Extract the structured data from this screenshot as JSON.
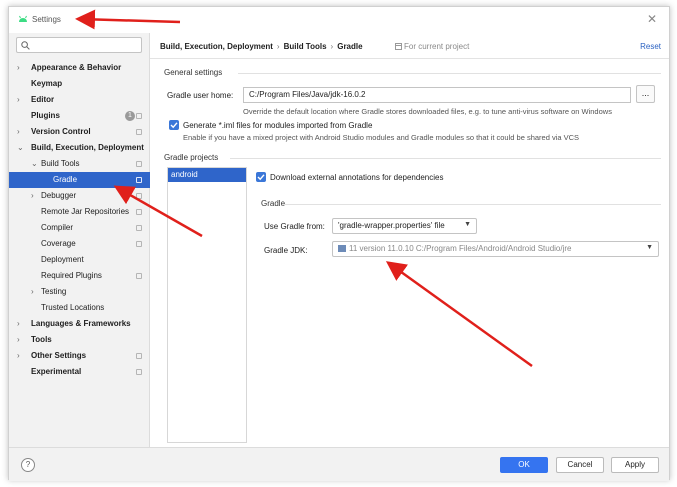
{
  "window": {
    "title": "Settings",
    "close_glyph": "✕"
  },
  "search": {
    "placeholder": ""
  },
  "sidebar": {
    "items": [
      {
        "label": "Appearance & Behavior",
        "chevron": "›",
        "bold": true,
        "level": 0
      },
      {
        "label": "Keymap",
        "chevron": "",
        "bold": true,
        "level": 0
      },
      {
        "label": "Editor",
        "chevron": "›",
        "bold": true,
        "level": 0
      },
      {
        "label": "Plugins",
        "chevron": "",
        "bold": true,
        "level": 0,
        "badge": "1",
        "cfg": true
      },
      {
        "label": "Version Control",
        "chevron": "›",
        "bold": true,
        "level": 0,
        "cfg": true
      },
      {
        "label": "Build, Execution, Deployment",
        "chevron": "⌄",
        "bold": true,
        "level": 0
      },
      {
        "label": "Build Tools",
        "chevron": "⌄",
        "bold": false,
        "level": 1,
        "cfg": true
      },
      {
        "label": "Gradle",
        "chevron": "",
        "bold": false,
        "level": 2,
        "cfg": true,
        "selected": true
      },
      {
        "label": "Debugger",
        "chevron": "›",
        "bold": false,
        "level": 1,
        "cfg": true
      },
      {
        "label": "Remote Jar Repositories",
        "chevron": "",
        "bold": false,
        "level": 1,
        "cfg": true
      },
      {
        "label": "Compiler",
        "chevron": "",
        "bold": false,
        "level": 1,
        "cfg": true
      },
      {
        "label": "Coverage",
        "chevron": "",
        "bold": false,
        "level": 1,
        "cfg": true
      },
      {
        "label": "Deployment",
        "chevron": "",
        "bold": false,
        "level": 1
      },
      {
        "label": "Required Plugins",
        "chevron": "",
        "bold": false,
        "level": 1,
        "cfg": true
      },
      {
        "label": "Testing",
        "chevron": "›",
        "bold": false,
        "level": 1
      },
      {
        "label": "Trusted Locations",
        "chevron": "",
        "bold": false,
        "level": 1
      },
      {
        "label": "Languages & Frameworks",
        "chevron": "›",
        "bold": true,
        "level": 0
      },
      {
        "label": "Tools",
        "chevron": "›",
        "bold": true,
        "level": 0
      },
      {
        "label": "Other Settings",
        "chevron": "›",
        "bold": true,
        "level": 0,
        "cfg": true
      },
      {
        "label": "Experimental",
        "chevron": "",
        "bold": true,
        "level": 0,
        "cfg": true
      }
    ]
  },
  "breadcrumb": {
    "part1": "Build, Execution, Deployment",
    "part2": "Build Tools",
    "part3": "Gradle",
    "sep": "›",
    "for_project": "For current project"
  },
  "reset_label": "Reset",
  "general": {
    "section_title": "General settings",
    "user_home_label": "Gradle user home:",
    "user_home_value": "C:/Program Files/Java/jdk-16.0.2",
    "browse_label": "...",
    "user_home_hint": "Override the default location where Gradle stores downloaded files, e.g. to tune anti-virus software on Windows",
    "generate_iml_label": "Generate *.iml files for modules imported from Gradle",
    "generate_iml_checked": true,
    "generate_iml_hint": "Enable if you have a mixed project with Android Studio modules and Gradle modules so that it could be shared via VCS"
  },
  "projects": {
    "section_title": "Gradle projects",
    "list": [
      "android"
    ],
    "download_annotations_label": "Download external annotations for dependencies",
    "download_annotations_checked": true,
    "gradle_subsection": "Gradle",
    "use_gradle_from_label": "Use Gradle from:",
    "use_gradle_from_value": "'gradle-wrapper.properties' file",
    "gradle_jdk_label": "Gradle JDK:",
    "gradle_jdk_value": "11 version 11.0.10 C:/Program Files/Android/Android Studio/jre"
  },
  "footer": {
    "help": "?",
    "ok": "OK",
    "cancel": "Cancel",
    "apply": "Apply"
  },
  "colors": {
    "accent": "#2f65ca",
    "button_primary": "#3574f0",
    "annotation": "#e0201b"
  }
}
